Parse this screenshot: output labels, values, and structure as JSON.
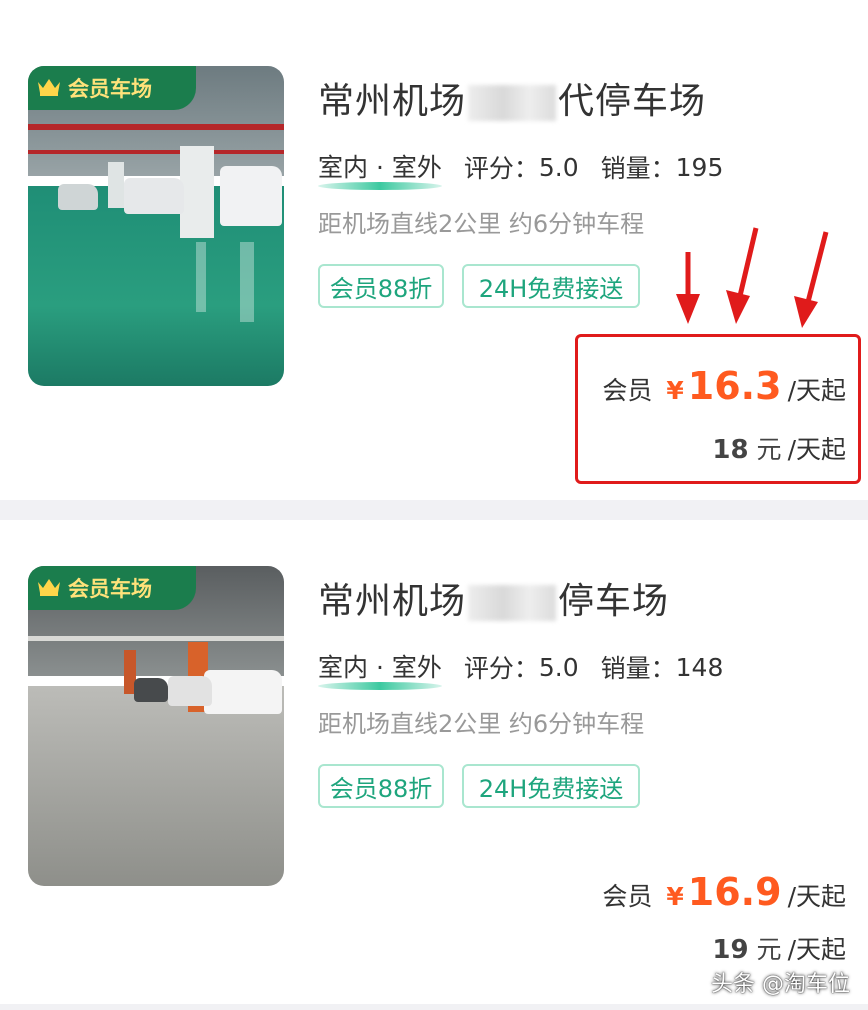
{
  "listings": [
    {
      "member_tag": "会员车场",
      "title_left": "常州机场",
      "title_right": "代停车场",
      "loc_type": "室内 · 室外",
      "rating_label": "评分：",
      "rating_value": "5.0",
      "sales_label": "销量：",
      "sales_value": "195",
      "distance": "距机场直线2公里 约6分钟车程",
      "tags": [
        "会员88折",
        "24H免费接送"
      ],
      "member_label": "会员",
      "currency": "¥",
      "member_price": "16.3",
      "price_unit": "/天起",
      "regular_price": "18",
      "yuan": "元",
      "regular_unit": "/天起",
      "highlighted": true
    },
    {
      "member_tag": "会员车场",
      "title_left": "常州机场",
      "title_right": "停车场",
      "loc_type": "室内 · 室外",
      "rating_label": "评分：",
      "rating_value": "5.0",
      "sales_label": "销量：",
      "sales_value": "148",
      "distance": "距机场直线2公里 约6分钟车程",
      "tags": [
        "会员88折",
        "24H免费接送"
      ],
      "member_label": "会员",
      "currency": "¥",
      "member_price": "16.9",
      "price_unit": "/天起",
      "regular_price": "19",
      "yuan": "元",
      "regular_unit": "/天起",
      "highlighted": false
    }
  ],
  "watermark": "头条 @淘车位",
  "colors": {
    "accent_orange": "#ff5a1f",
    "tag_green": "#1ea57d",
    "member_tag_bg": "#1b7d4d",
    "highlight_red": "#e01b1b"
  }
}
